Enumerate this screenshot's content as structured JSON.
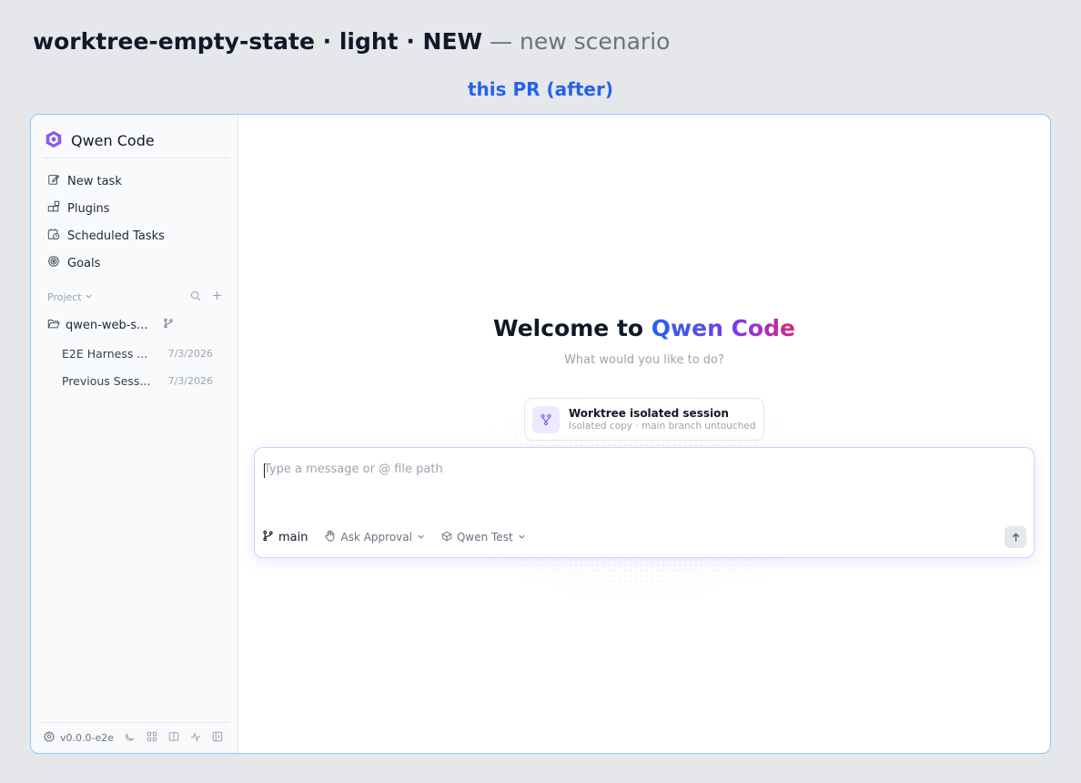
{
  "heading": {
    "bold": "worktree-empty-state · light · NEW",
    "light": "— new scenario"
  },
  "variant_label": "this PR (after)",
  "app": {
    "name": "Qwen Code",
    "nav": [
      {
        "label": "New task",
        "icon": "edit-icon"
      },
      {
        "label": "Plugins",
        "icon": "plugins-icon"
      },
      {
        "label": "Scheduled Tasks",
        "icon": "calendar-clock-icon"
      },
      {
        "label": "Goals",
        "icon": "target-icon"
      }
    ],
    "project": {
      "header": "Project",
      "folder": "qwen-web-s...",
      "sessions": [
        {
          "title": "E2E Harness ...",
          "date": "7/3/2026"
        },
        {
          "title": "Previous Sess...",
          "date": "7/3/2026"
        }
      ]
    },
    "footer": {
      "version": "v0.0.0-e2e"
    }
  },
  "main": {
    "welcome_prefix": "Welcome to ",
    "welcome_brand": "Qwen Code",
    "subtitle": "What would you like to do?",
    "worktree_card": {
      "title": "Worktree isolated session",
      "description": "Isolated copy · main branch untouched"
    },
    "composer": {
      "placeholder": "Type a message or @ file path",
      "branch": "main",
      "approval": "Ask Approval",
      "model": "Qwen Test"
    }
  },
  "colors": {
    "accent": "#2563eb",
    "frame_border": "#93c5fd",
    "composer_border": "#c7d2fe",
    "worktree_icon_bg": "#ede9fe"
  }
}
